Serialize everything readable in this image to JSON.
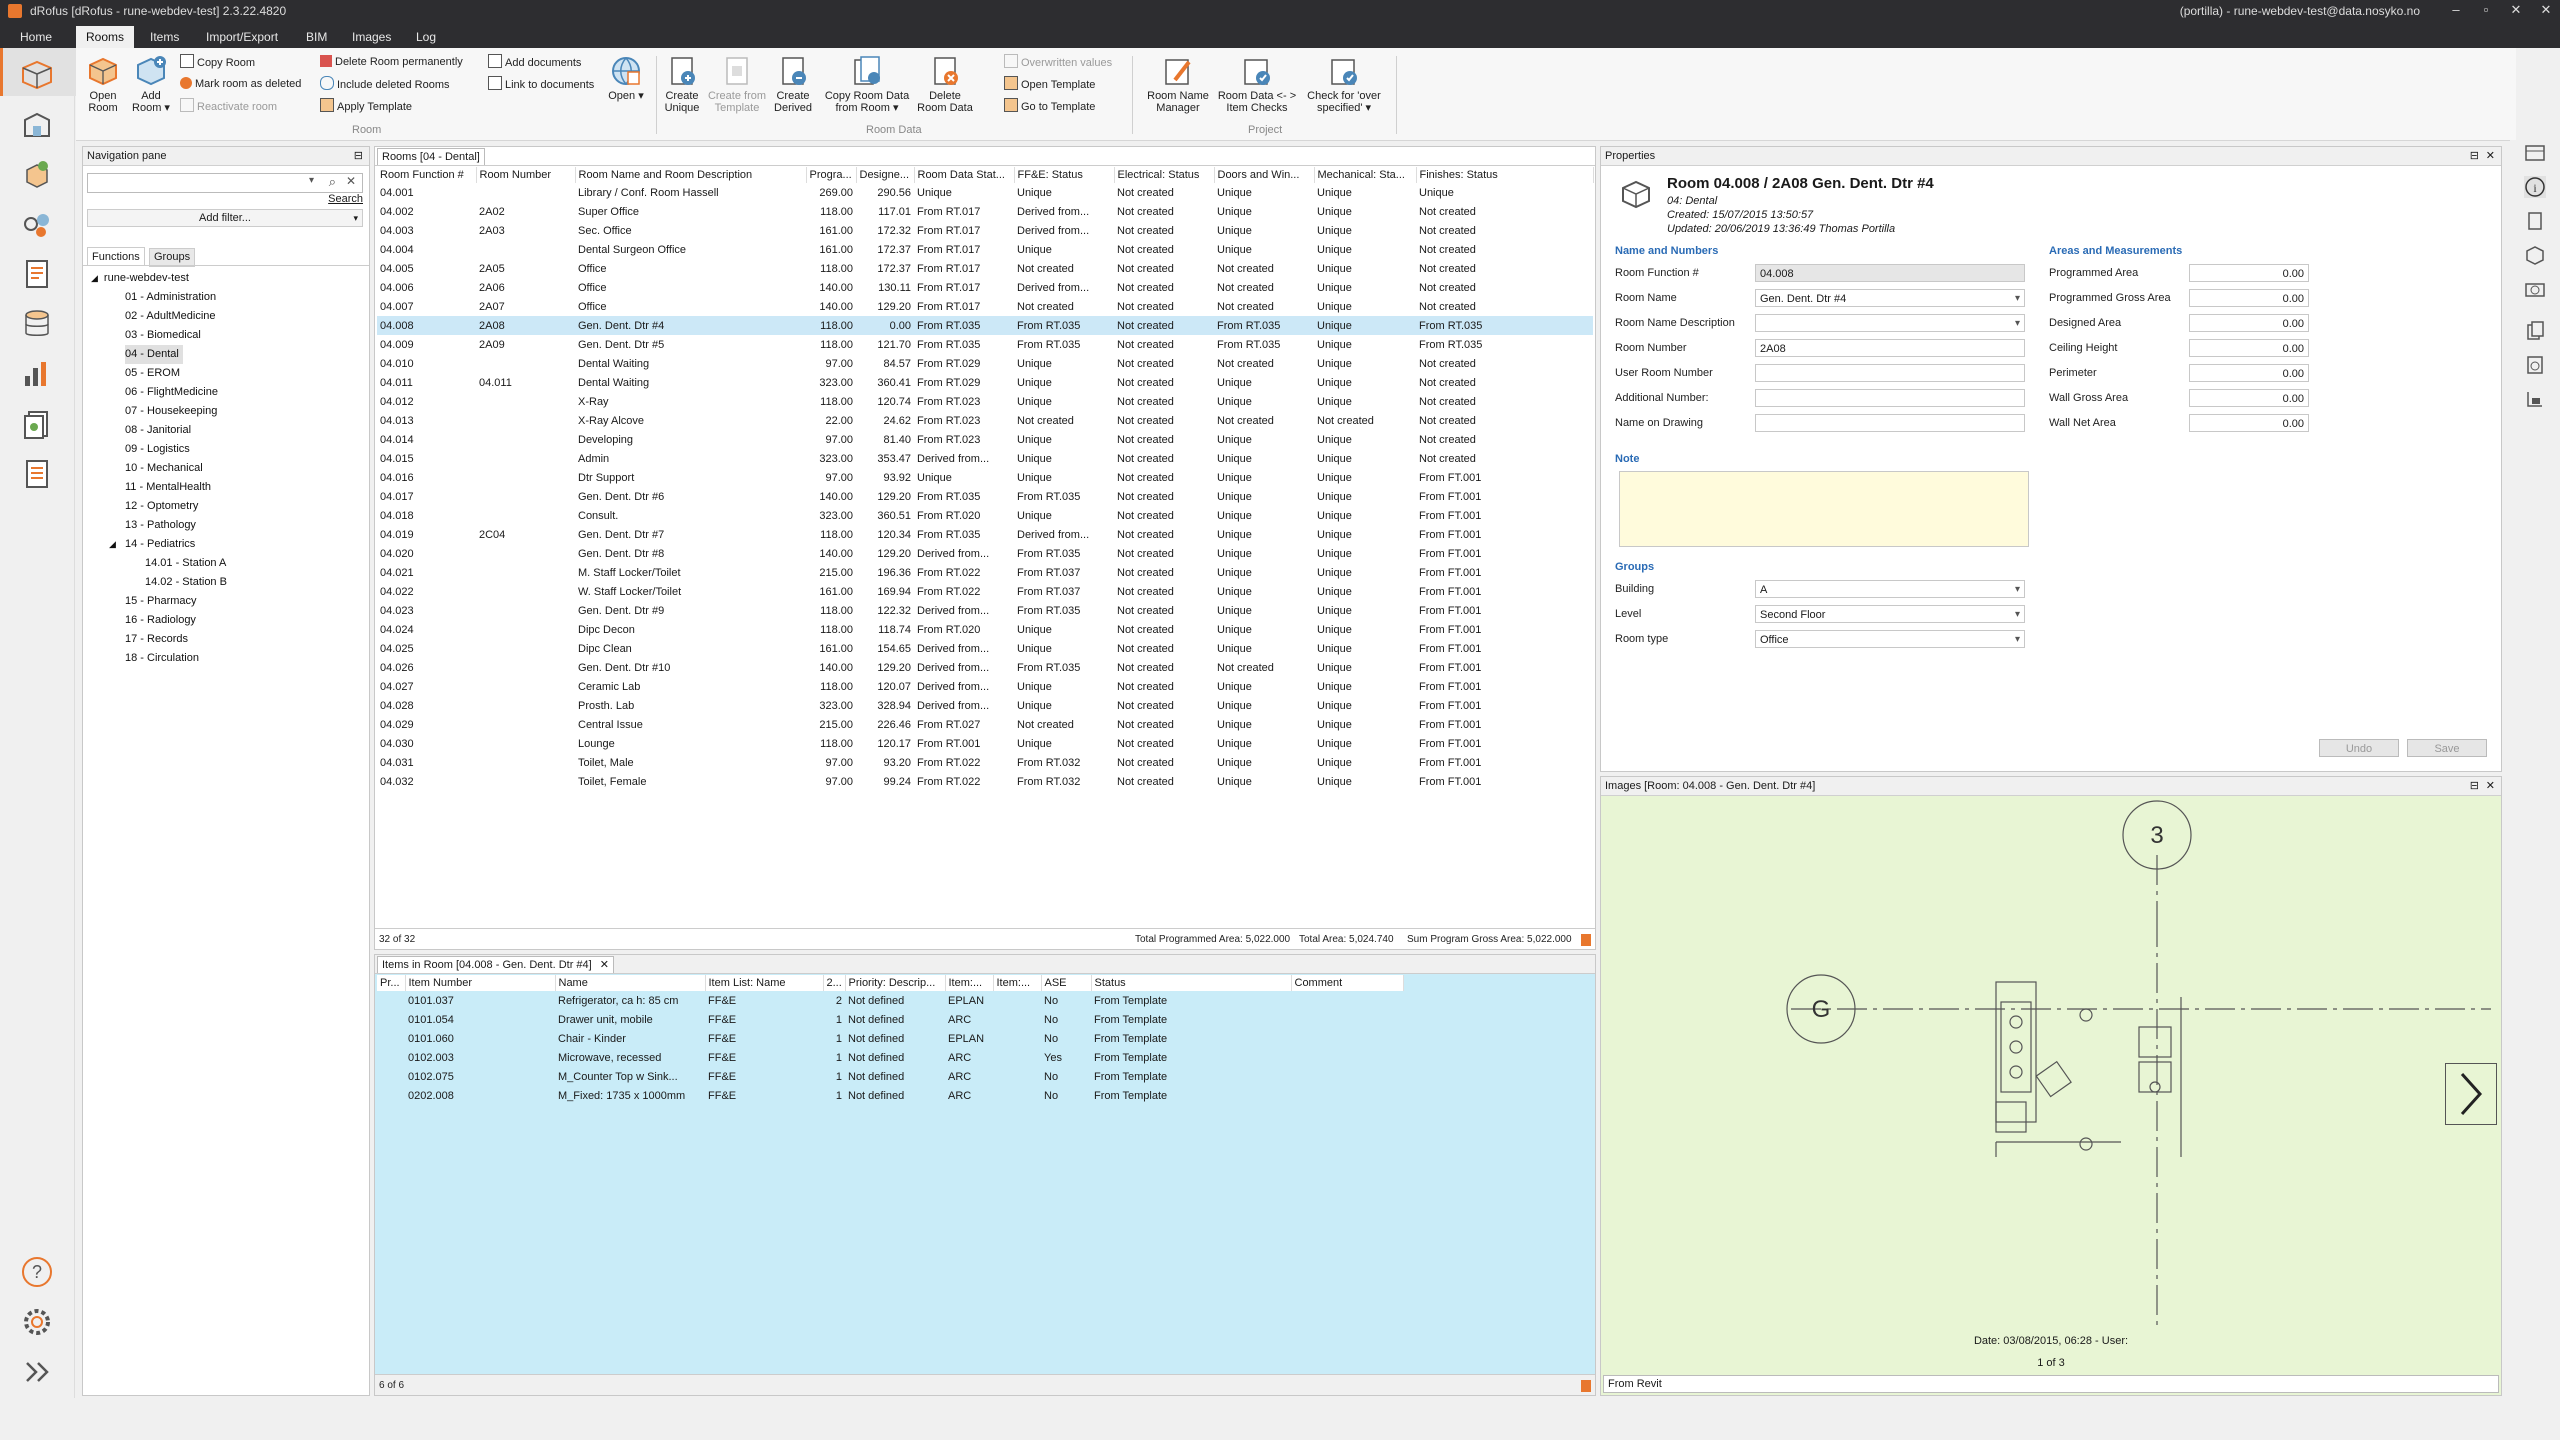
{
  "window": {
    "title": "dRofus [dRofus - rune-webdev-test] 2.3.22.4820",
    "user": "(portilla) - rune-webdev-test@data.nosyko.no",
    "controls": [
      "–",
      "▫",
      "✕",
      "✕"
    ]
  },
  "menu": {
    "tabs": [
      "Home",
      "Rooms",
      "Items",
      "Import/Export",
      "BIM",
      "Images",
      "Log"
    ],
    "active": "Rooms"
  },
  "ribbon": {
    "open_room": "Open Room",
    "add_room": "Add Room ▾",
    "copy_room": "Copy Room",
    "mark_deleted": "Mark room as deleted",
    "reactivate": "Reactivate room",
    "delete_perm": "Delete Room permanently",
    "include_deleted": "Include deleted Rooms",
    "apply_template": "Apply Template",
    "add_documents": "Add documents",
    "link_documents": "Link to documents",
    "open": "Open ▾",
    "group_room": "Room",
    "create_unique": "Create Unique",
    "create_from_template": "Create from Template",
    "create_derived": "Create Derived",
    "copy_room_data": "Copy Room Data from Room ▾",
    "delete_room_data": "Delete Room Data",
    "overwritten_values": "Overwritten values",
    "open_template": "Open Template",
    "go_to_template": "Go to Template",
    "group_room_data": "Room Data",
    "room_name_manager": "Room Name Manager",
    "room_data_item_checks": "Room Data <- > Item Checks",
    "check_over_specified": "Check for 'over specified' ▾",
    "group_project": "Project"
  },
  "nav": {
    "title": "Navigation pane",
    "pin": "⊟",
    "search_label": "Search",
    "add_filter": "Add filter...",
    "tabs": [
      "Functions",
      "Groups"
    ],
    "root": "rune-webdev-test",
    "items": [
      "01 - Administration",
      "02 - AdultMedicine",
      "03 - Biomedical",
      "04 - Dental",
      "05 - EROM",
      "06 - FlightMedicine",
      "07 - Housekeeping",
      "08 - Janitorial",
      "09 - Logistics",
      "10 - Mechanical",
      "11 - MentalHealth",
      "12 - Optometry",
      "13 - Pathology",
      "14 - Pediatrics"
    ],
    "subitems": [
      "14.01 - Station A",
      "14.02 - Station B"
    ],
    "items_after": [
      "15 - Pharmacy",
      "16 - Radiology",
      "17 - Records",
      "18 - Circulation"
    ],
    "selected": "04 - Dental"
  },
  "rooms": {
    "tab": "Rooms [04 - Dental]",
    "columns": [
      "Room Function #",
      "Room Number",
      "Room Name and Room Description",
      "Progra...",
      "Designe...",
      "Room Data Stat...",
      "FF&E: Status",
      "Electrical: Status",
      "Doors and Win...",
      "Mechanical: Sta...",
      "Finishes: Status"
    ],
    "rows": [
      [
        "04.001",
        "",
        "Library / Conf. Room Hassell",
        "269.00",
        "290.56",
        "Unique",
        "Unique",
        "Not created",
        "Unique",
        "Unique",
        "Unique"
      ],
      [
        "04.002",
        "2A02",
        "Super Office",
        "118.00",
        "117.01",
        "From RT.017",
        "Derived from...",
        "Not created",
        "Unique",
        "Unique",
        "Not created"
      ],
      [
        "04.003",
        "2A03",
        "Sec. Office",
        "161.00",
        "172.32",
        "From RT.017",
        "Derived from...",
        "Not created",
        "Unique",
        "Unique",
        "Not created"
      ],
      [
        "04.004",
        "",
        "Dental Surgeon Office",
        "161.00",
        "172.37",
        "From RT.017",
        "Unique",
        "Not created",
        "Unique",
        "Unique",
        "Not created"
      ],
      [
        "04.005",
        "2A05",
        "Office",
        "118.00",
        "172.37",
        "From RT.017",
        "Not created",
        "Not created",
        "Not created",
        "Unique",
        "Not created"
      ],
      [
        "04.006",
        "2A06",
        "Office",
        "140.00",
        "130.11",
        "From RT.017",
        "Derived from...",
        "Not created",
        "Not created",
        "Unique",
        "Not created"
      ],
      [
        "04.007",
        "2A07",
        "Office",
        "140.00",
        "129.20",
        "From RT.017",
        "Not created",
        "Not created",
        "Not created",
        "Unique",
        "Not created"
      ],
      [
        "04.008",
        "2A08",
        "Gen. Dent. Dtr #4",
        "118.00",
        "0.00",
        "From RT.035",
        "From RT.035",
        "Not created",
        "From RT.035",
        "Unique",
        "From RT.035"
      ],
      [
        "04.009",
        "2A09",
        "Gen. Dent. Dtr #5",
        "118.00",
        "121.70",
        "From RT.035",
        "From RT.035",
        "Not created",
        "From RT.035",
        "Unique",
        "From RT.035"
      ],
      [
        "04.010",
        "",
        "Dental Waiting",
        "97.00",
        "84.57",
        "From RT.029",
        "Unique",
        "Not created",
        "Not created",
        "Unique",
        "Not created"
      ],
      [
        "04.011",
        "04.011",
        "Dental Waiting",
        "323.00",
        "360.41",
        "From RT.029",
        "Unique",
        "Not created",
        "Unique",
        "Unique",
        "Not created"
      ],
      [
        "04.012",
        "",
        "X-Ray",
        "118.00",
        "120.74",
        "From RT.023",
        "Unique",
        "Not created",
        "Unique",
        "Unique",
        "Not created"
      ],
      [
        "04.013",
        "",
        "X-Ray Alcove",
        "22.00",
        "24.62",
        "From RT.023",
        "Not created",
        "Not created",
        "Not created",
        "Not created",
        "Not created"
      ],
      [
        "04.014",
        "",
        "Developing",
        "97.00",
        "81.40",
        "From RT.023",
        "Unique",
        "Not created",
        "Unique",
        "Unique",
        "Not created"
      ],
      [
        "04.015",
        "",
        "Admin",
        "323.00",
        "353.47",
        "Derived from...",
        "Unique",
        "Not created",
        "Unique",
        "Unique",
        "Not created"
      ],
      [
        "04.016",
        "",
        "Dtr Support",
        "97.00",
        "93.92",
        "Unique",
        "Unique",
        "Not created",
        "Unique",
        "Unique",
        "From FT.001"
      ],
      [
        "04.017",
        "",
        "Gen. Dent. Dtr #6",
        "140.00",
        "129.20",
        "From RT.035",
        "From RT.035",
        "Not created",
        "Unique",
        "Unique",
        "From FT.001"
      ],
      [
        "04.018",
        "",
        "Consult.",
        "323.00",
        "360.51",
        "From RT.020",
        "Unique",
        "Not created",
        "Unique",
        "Unique",
        "From FT.001"
      ],
      [
        "04.019",
        "2C04",
        "Gen. Dent. Dtr #7",
        "118.00",
        "120.34",
        "From RT.035",
        "Derived from...",
        "Not created",
        "Unique",
        "Unique",
        "From FT.001"
      ],
      [
        "04.020",
        "",
        "Gen. Dent. Dtr #8",
        "140.00",
        "129.20",
        "Derived from...",
        "From RT.035",
        "Not created",
        "Unique",
        "Unique",
        "From FT.001"
      ],
      [
        "04.021",
        "",
        "M. Staff Locker/Toilet",
        "215.00",
        "196.36",
        "From RT.022",
        "From RT.037",
        "Not created",
        "Unique",
        "Unique",
        "From FT.001"
      ],
      [
        "04.022",
        "",
        "W. Staff Locker/Toilet",
        "161.00",
        "169.94",
        "From RT.022",
        "From RT.037",
        "Not created",
        "Unique",
        "Unique",
        "From FT.001"
      ],
      [
        "04.023",
        "",
        "Gen. Dent. Dtr #9",
        "118.00",
        "122.32",
        "Derived from...",
        "From RT.035",
        "Not created",
        "Unique",
        "Unique",
        "From FT.001"
      ],
      [
        "04.024",
        "",
        "Dipc Decon",
        "118.00",
        "118.74",
        "From RT.020",
        "Unique",
        "Not created",
        "Unique",
        "Unique",
        "From FT.001"
      ],
      [
        "04.025",
        "",
        "Dipc Clean",
        "161.00",
        "154.65",
        "Derived from...",
        "Unique",
        "Not created",
        "Unique",
        "Unique",
        "From FT.001"
      ],
      [
        "04.026",
        "",
        "Gen. Dent. Dtr #10",
        "140.00",
        "129.20",
        "Derived from...",
        "From RT.035",
        "Not created",
        "Not created",
        "Unique",
        "From FT.001"
      ],
      [
        "04.027",
        "",
        "Ceramic Lab",
        "118.00",
        "120.07",
        "Derived from...",
        "Unique",
        "Not created",
        "Unique",
        "Unique",
        "From FT.001"
      ],
      [
        "04.028",
        "",
        "Prosth. Lab",
        "323.00",
        "328.94",
        "Derived from...",
        "Unique",
        "Not created",
        "Unique",
        "Unique",
        "From FT.001"
      ],
      [
        "04.029",
        "",
        "Central Issue",
        "215.00",
        "226.46",
        "From RT.027",
        "Not created",
        "Not created",
        "Unique",
        "Unique",
        "From FT.001"
      ],
      [
        "04.030",
        "",
        "Lounge",
        "118.00",
        "120.17",
        "From RT.001",
        "Unique",
        "Not created",
        "Unique",
        "Unique",
        "From FT.001"
      ],
      [
        "04.031",
        "",
        "Toilet, Male",
        "97.00",
        "93.20",
        "From RT.022",
        "From RT.032",
        "Not created",
        "Unique",
        "Unique",
        "From FT.001"
      ],
      [
        "04.032",
        "",
        "Toilet, Female",
        "97.00",
        "99.24",
        "From RT.022",
        "From RT.032",
        "Not created",
        "Unique",
        "Unique",
        "From FT.001"
      ]
    ],
    "selected_index": 7,
    "count": "32 of 32",
    "total_programmed": "Total Programmed Area: 5,022.000",
    "total_area": "Total Area: 5,024.740",
    "sum_gross": "Sum Program Gross Area: 5,022.000"
  },
  "items": {
    "tab": "Items in Room [04.008 - Gen. Dent. Dtr #4]",
    "close": "✕",
    "columns": [
      "Pr...",
      "Item Number",
      "Name",
      "Item List: Name",
      "2...",
      "Priority: Descrip...",
      "Item:...",
      "Item:...",
      "ASE",
      "Status",
      "Comment"
    ],
    "rows": [
      [
        "",
        "0101.037",
        "Refrigerator, ca h: 85 cm",
        "FF&E",
        "2",
        "Not defined",
        "EPLAN",
        "",
        "No",
        "From Template",
        ""
      ],
      [
        "",
        "0101.054",
        "Drawer unit, mobile",
        "FF&E",
        "1",
        "Not defined",
        "ARC",
        "",
        "No",
        "From Template",
        ""
      ],
      [
        "",
        "0101.060",
        "Chair - Kinder",
        "FF&E",
        "1",
        "Not defined",
        "EPLAN",
        "",
        "No",
        "From Template",
        ""
      ],
      [
        "",
        "0102.003",
        "Microwave, recessed",
        "FF&E",
        "1",
        "Not defined",
        "ARC",
        "",
        "Yes",
        "From Template",
        ""
      ],
      [
        "",
        "0102.075",
        "M_Counter Top w Sink...",
        "FF&E",
        "1",
        "Not defined",
        "ARC",
        "",
        "No",
        "From Template",
        ""
      ],
      [
        "",
        "0202.008",
        "M_Fixed: 1735 x 1000mm",
        "FF&E",
        "1",
        "Not defined",
        "ARC",
        "",
        "No",
        "From Template",
        ""
      ]
    ],
    "count": "6 of 6"
  },
  "properties": {
    "title": "Properties",
    "room_title": "Room 04.008 / 2A08 Gen. Dent. Dtr #4",
    "subtitle": "04: Dental",
    "created": "Created: 15/07/2015 13:50:57",
    "updated": "Updated: 20/06/2019 13:36:49 Thomas Portilla",
    "name_numbers_title": "Name and Numbers",
    "areas_title": "Areas and Measurements",
    "fields": [
      {
        "label": "Room Function #",
        "value": "04.008"
      },
      {
        "label": "Room Name",
        "value": "Gen. Dent. Dtr #4"
      },
      {
        "label": "Room Name Description",
        "value": ""
      },
      {
        "label": "Room Number",
        "value": "2A08"
      },
      {
        "label": "User Room Number",
        "value": ""
      },
      {
        "label": "Additional Number:",
        "value": ""
      },
      {
        "label": "Name on Drawing",
        "value": ""
      }
    ],
    "areas": [
      {
        "label": "Programmed Area",
        "value": "0.00"
      },
      {
        "label": "Programmed Gross Area",
        "value": "0.00"
      },
      {
        "label": "Designed Area",
        "value": "0.00"
      },
      {
        "label": "Ceiling Height",
        "value": "0.00"
      },
      {
        "label": "Perimeter",
        "value": "0.00"
      },
      {
        "label": "Wall Gross Area",
        "value": "0.00"
      },
      {
        "label": "Wall Net Area",
        "value": "0.00"
      }
    ],
    "note_title": "Note",
    "groups_title": "Groups",
    "groups": [
      {
        "label": "Building",
        "value": "A"
      },
      {
        "label": "Level",
        "value": "Second Floor"
      },
      {
        "label": "Room type",
        "value": "Office"
      }
    ],
    "undo": "Undo",
    "save": "Save"
  },
  "images": {
    "title": "Images [Room: 04.008 - Gen. Dent. Dtr #4]",
    "grid_label_top": "3",
    "grid_label_left": "G",
    "date": "Date: 03/08/2015, 06:28 - User:",
    "pager": "1 of 3",
    "source": "From Revit",
    "bg": "#e8f5d4"
  },
  "colors": {
    "accent": "#e8772e",
    "selection": "#cce8f7",
    "items_bg": "#c9ecf8",
    "note_bg": "#fffbdc",
    "section": "#2a6bb5"
  }
}
